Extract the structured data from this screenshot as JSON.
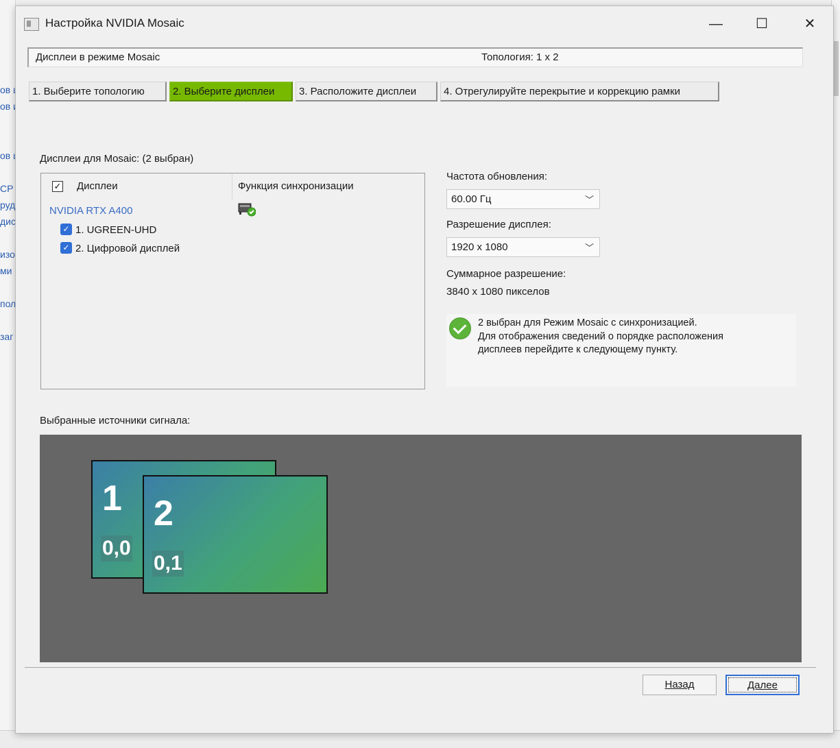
{
  "background_fragments": [
    "ов ц",
    "ов и",
    "ов ц",
    "СР",
    "руд",
    "дис",
    "изо",
    "ми",
    "пол",
    "заг"
  ],
  "window": {
    "title": "Настройка NVIDIA Mosaic",
    "controls": {
      "minimize": "—",
      "maximize": "☐",
      "close": "✕"
    }
  },
  "info_bar": {
    "left": "Дисплеи в режиме Mosaic",
    "right": "Топология:  1 x 2"
  },
  "steps": [
    {
      "label": "1. Выберите топологию",
      "active": false
    },
    {
      "label": "2. Выберите дисплеи",
      "active": true
    },
    {
      "label": "3. Расположите дисплеи",
      "active": false
    },
    {
      "label": "4. Отрегулируйте перекрытие и коррекцию рамки",
      "active": false
    }
  ],
  "displays_section": {
    "label": "Дисплеи для Mosaic: (2 выбран)",
    "col_displays": "Дисплеи",
    "col_sync": "Функция синхронизации",
    "gpu": "NVIDIA RTX A400",
    "items": [
      {
        "label": "1. UGREEN-UHD",
        "checked": true
      },
      {
        "label": "2. Цифровой дисплей",
        "checked": true
      }
    ],
    "header_checked": true
  },
  "settings": {
    "refresh_label": "Частота обновления:",
    "refresh_value": "60.00 Гц",
    "resolution_label": "Разрешение дисплея:",
    "resolution_value": "1920 x 1080",
    "total_label": "Суммарное разрешение:",
    "total_value": "3840 x 1080 пикселов"
  },
  "message": {
    "line1": "2 выбран для Режим Mosaic с синхронизацией.",
    "line2": "Для отображения сведений о порядке расположения",
    "line3": "дисплеев перейдите к следующему пункту."
  },
  "sources": {
    "label": "Выбранные источники сигнала:",
    "monitors": [
      {
        "number": "1",
        "coord": "0,0"
      },
      {
        "number": "2",
        "coord": "0,1"
      }
    ]
  },
  "buttons": {
    "back": "Назад",
    "next": "Далее"
  },
  "colors": {
    "accent": "#76b900",
    "preview_bg": "#666666",
    "link": "#3a6cc4",
    "checkbox": "#2f6fd6"
  }
}
